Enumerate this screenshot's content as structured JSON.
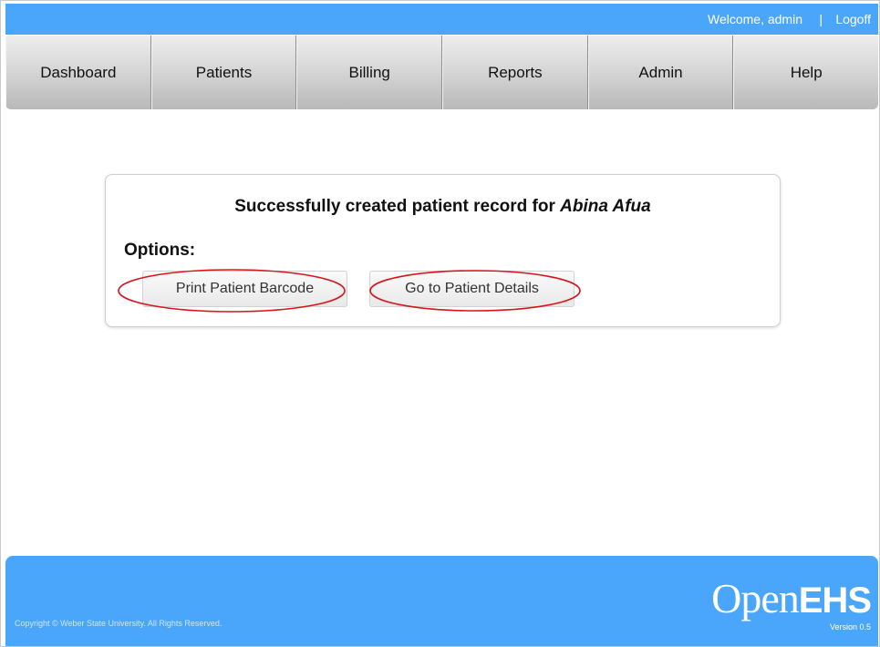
{
  "topbar": {
    "welcome": "Welcome, admin",
    "separator": "|",
    "logoff": "Logoff"
  },
  "nav": {
    "items": [
      {
        "label": "Dashboard"
      },
      {
        "label": "Patients"
      },
      {
        "label": "Billing"
      },
      {
        "label": "Reports"
      },
      {
        "label": "Admin"
      },
      {
        "label": "Help"
      }
    ]
  },
  "main": {
    "message_prefix": "Successfully created patient record for ",
    "patient_name": "Abina Afua",
    "options_label": "Options:",
    "buttons": {
      "print_barcode": "Print Patient Barcode",
      "patient_details": "Go to Patient Details"
    }
  },
  "footer": {
    "copyright": "Copyright © Weber State University. All Rights Reserved.",
    "logo_light": "Open",
    "logo_bold": "EHS",
    "version": "Version 0.5"
  },
  "colors": {
    "brand_blue": "#4aa6fb",
    "annotation_red": "#d9141c"
  }
}
